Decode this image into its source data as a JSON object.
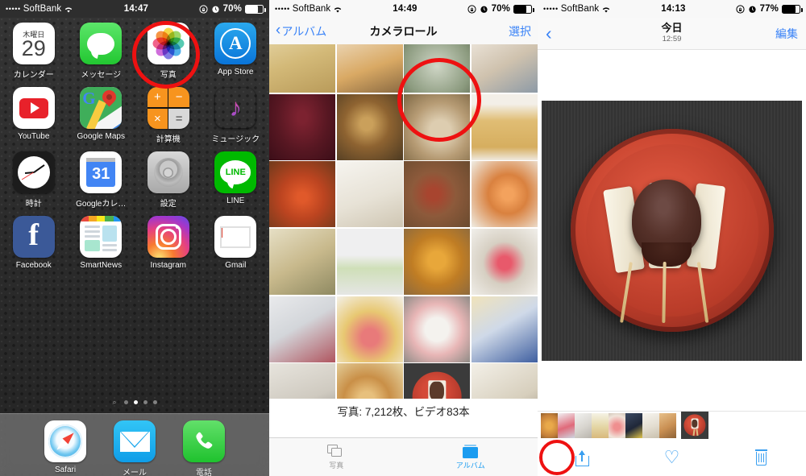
{
  "panels": {
    "home": {
      "statusbar": {
        "signal": "•••••",
        "carrier": "SoftBank",
        "time": "14:47",
        "battery_pct": "70%"
      },
      "apps": [
        {
          "label": "カレンダー",
          "icon": "calendar-icon",
          "day_of_week": "木曜日",
          "day": "29"
        },
        {
          "label": "メッセージ",
          "icon": "messages-icon"
        },
        {
          "label": "写真",
          "icon": "photos-icon",
          "highlighted": true
        },
        {
          "label": "App Store",
          "icon": "appstore-icon",
          "glyph": "A"
        },
        {
          "label": "YouTube",
          "icon": "youtube-icon"
        },
        {
          "label": "Google Maps",
          "icon": "googlemaps-icon",
          "glyph": "G"
        },
        {
          "label": "計算機",
          "icon": "calculator-icon",
          "keys": [
            "+",
            "−",
            "×",
            "="
          ]
        },
        {
          "label": "ミュージック",
          "icon": "music-icon",
          "glyph": "♪"
        },
        {
          "label": "時計",
          "icon": "clock-icon"
        },
        {
          "label": "Googleカレ…",
          "icon": "googlecalendar-icon",
          "day": "31"
        },
        {
          "label": "設定",
          "icon": "settings-icon"
        },
        {
          "label": "LINE",
          "icon": "line-icon",
          "glyph": "LINE"
        },
        {
          "label": "Facebook",
          "icon": "facebook-icon",
          "glyph": "f"
        },
        {
          "label": "SmartNews",
          "icon": "smartnews-icon"
        },
        {
          "label": "Instagram",
          "icon": "instagram-icon"
        },
        {
          "label": "Gmail",
          "icon": "gmail-icon"
        }
      ],
      "page_dots": {
        "count": 4,
        "active_index": 1,
        "search_glyph": "⌕"
      },
      "dock": [
        {
          "label": "Safari",
          "icon": "safari-icon"
        },
        {
          "label": "メール",
          "icon": "mail-icon"
        },
        {
          "label": "電話",
          "icon": "phone-icon",
          "glyph": "📞"
        }
      ]
    },
    "album": {
      "statusbar": {
        "signal": "•••••",
        "carrier": "SoftBank",
        "time": "14:49",
        "battery_pct": "70%"
      },
      "nav": {
        "back_label": "アルバム",
        "title": "カメラロール",
        "right_label": "選択"
      },
      "count_text": "写真: 7,212枚、ビデオ83本",
      "tabs": [
        {
          "label": "写真",
          "icon": "photos-stack-icon",
          "active": false
        },
        {
          "label": "アルバム",
          "icon": "album-box-icon",
          "active": true
        }
      ],
      "grid": [
        [
          "noodles",
          "fried-food",
          "soup-bowl",
          "table-top"
        ],
        [
          "chocolate-cake",
          "grilled-skewers",
          "fried-rice-bowl",
          "juice-bottles"
        ],
        [
          "carrot-salad",
          "lace-cookies",
          "salami-sandwich",
          "salmon-toast"
        ],
        [
          "tempura-bowl",
          "green-drink-bottle",
          "pumpkin-bagel",
          "watermelon-plate"
        ],
        [
          "bento-containers",
          "heart-soup",
          "strawberry-bun",
          "blue-teacups"
        ],
        [
          "third-eye-bag",
          "anko-bread",
          "dango-plate",
          "blank"
        ]
      ],
      "highlighted_cell": {
        "row": 5,
        "col": 2,
        "name": "dango-plate"
      }
    },
    "photo": {
      "statusbar": {
        "signal": "•••••",
        "carrier": "SoftBank",
        "time": "14:13",
        "battery_pct": "77%"
      },
      "nav": {
        "title": "今日",
        "subtitle": "12:59",
        "right_label": "編集"
      },
      "main_photo": "dango-on-red-plate",
      "filmstrip": [
        "bagel",
        "sushi-cake",
        "desserts",
        "plated-dish",
        "strawberry",
        "dark-cup",
        "label-note",
        "anko-bread"
      ],
      "filmstrip_selected": "dango-plate",
      "toolbar": [
        {
          "name": "share-button",
          "icon": "share-icon",
          "highlighted": true
        },
        {
          "name": "favorite-button",
          "icon": "heart-icon",
          "glyph": "♡"
        },
        {
          "name": "delete-button",
          "icon": "trash-icon"
        }
      ]
    }
  },
  "annotations": {
    "color": "#ee1111",
    "circles": [
      {
        "target": "photos-app-icon",
        "panel": "home"
      },
      {
        "target": "dango-thumbnail",
        "panel": "album"
      },
      {
        "target": "share-button",
        "panel": "photo"
      }
    ]
  }
}
